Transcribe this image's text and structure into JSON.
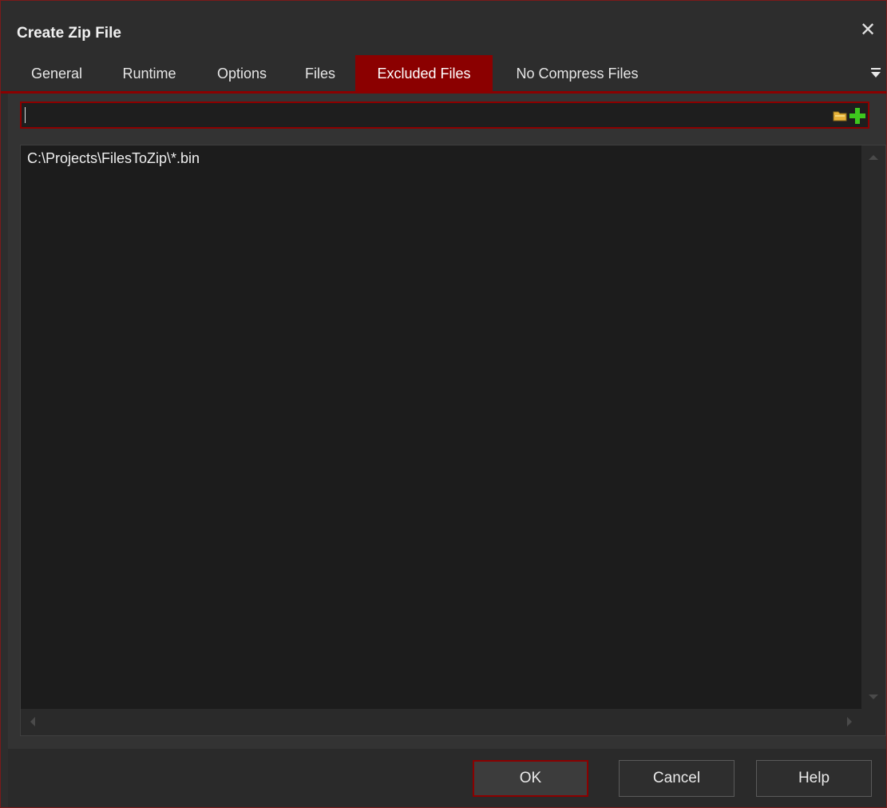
{
  "window": {
    "title": "Create Zip File"
  },
  "tabs": [
    {
      "label": "General"
    },
    {
      "label": "Runtime"
    },
    {
      "label": "Options"
    },
    {
      "label": "Files"
    },
    {
      "label": "Excluded Files",
      "active": true
    },
    {
      "label": "No Compress Files"
    }
  ],
  "excluded": {
    "input_value": "",
    "items": [
      "C:\\Projects\\FilesToZip\\*.bin"
    ]
  },
  "buttons": {
    "ok": "OK",
    "cancel": "Cancel",
    "help": "Help"
  },
  "icons": {
    "close": "close-icon",
    "tab_menu": "overflow-menu-icon",
    "browse": "folder-icon",
    "add": "add-icon"
  },
  "colors": {
    "accent": "#8b0000",
    "background": "#2d2d2d",
    "field": "#1c1c1c"
  }
}
